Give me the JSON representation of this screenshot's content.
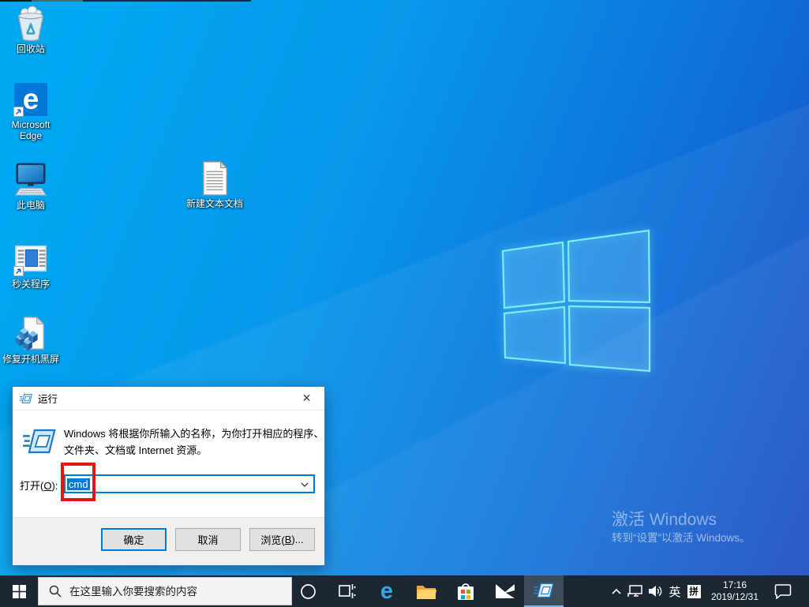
{
  "desktop": {
    "icons": [
      {
        "id": "recycle-bin",
        "label": "回收站"
      },
      {
        "id": "microsoft-edge",
        "label": "Microsoft Edge"
      },
      {
        "id": "this-pc",
        "label": "此电脑"
      },
      {
        "id": "quick-close-app",
        "label": "秒关程序"
      },
      {
        "id": "fix-black-screen",
        "label": "修复开机黑屏"
      },
      {
        "id": "new-text-doc",
        "label": "新建文本文档"
      }
    ],
    "watermark": {
      "title": "激活 Windows",
      "subtitle": "转到“设置”以激活 Windows。"
    }
  },
  "run_dialog": {
    "title": "运行",
    "close_glyph": "✕",
    "description_line1": "Windows 将根据你所输入的名称，为你打开相应的程序、",
    "description_line2": "文件夹、文档或 Internet 资源。",
    "open_label_pre": "打开(",
    "open_label_key": "O",
    "open_label_post": "):",
    "input_value": "cmd",
    "buttons": {
      "ok": "确定",
      "cancel": "取消",
      "browse_pre": "浏览(",
      "browse_key": "B",
      "browse_post": ")..."
    }
  },
  "annotation": {
    "color": "#e0170f",
    "purpose": "highlight cmd input"
  },
  "taskbar": {
    "search_placeholder": "在这里输入你要搜索的内容",
    "icons": [
      "start",
      "cortana",
      "task-view",
      "edge",
      "file-explorer",
      "store",
      "mail",
      "run-dialog-active"
    ],
    "edge_glyph": "e",
    "tray": {
      "ime_lang": "英",
      "ime_mode": "拼",
      "time": "17:16",
      "date": "2019/12/31"
    }
  },
  "colors": {
    "accent": "#0078d7",
    "taskbar_bg": "#1d2733",
    "selection_bg": "#0078d7",
    "annotation_red": "#e0170f"
  }
}
